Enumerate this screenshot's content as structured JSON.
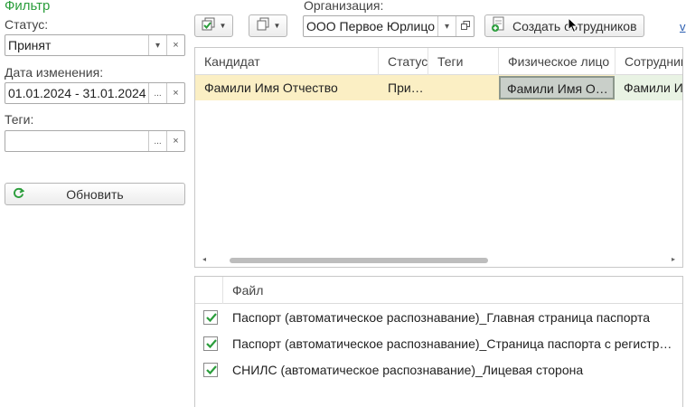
{
  "filter": {
    "title": "Фильтр",
    "status_label": "Статус:",
    "status_value": "Принят",
    "date_label": "Дата изменения:",
    "date_value": "01.01.2024 - 31.01.2024",
    "tags_label": "Теги:",
    "tags_value": "",
    "refresh_label": "Обновить",
    "icons": {
      "dropdown": "chevron-down-icon",
      "clear": "close-icon",
      "select": "ellipsis-icon",
      "refresh": "refresh-icon"
    }
  },
  "toolbar": {
    "check_all_icon": "check-all-icon",
    "copy_icon": "copy-icon",
    "org_label": "Организация:",
    "org_value": "ООО Первое Юрлицо",
    "open_icon": "open-window-icon",
    "create_label": "Создать сотрудников",
    "create_icon": "create-document-icon",
    "link_text": "v"
  },
  "candidates": {
    "columns": [
      "Кандидат",
      "Статус",
      "Теги",
      "Физическое лицо",
      "Сотрудник"
    ],
    "rows": [
      {
        "candidate": "Фамили Имя Отчество",
        "status": "При…",
        "tags": "",
        "person": "Фамили Имя О…",
        "employee": "Фамили Им"
      }
    ]
  },
  "files": {
    "column": "Файл",
    "rows": [
      {
        "checked": true,
        "name": "Паспорт (автоматическое распознавание)_Главная страница паспорта"
      },
      {
        "checked": true,
        "name": "Паспорт (автоматическое распознавание)_Страница паспорта с регистрац…"
      },
      {
        "checked": true,
        "name": "СНИЛС (автоматическое распознавание)_Лицевая сторона"
      }
    ]
  },
  "colors": {
    "accent_green": "#2a9d3b",
    "row_highlight": "#fbefc4",
    "selected_cell": "#c9cfc9"
  }
}
